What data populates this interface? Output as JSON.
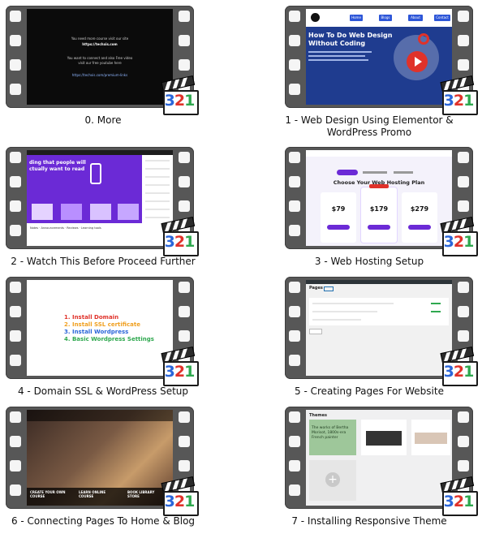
{
  "colors": {
    "accent_red": "#e0322a",
    "accent_blue": "#2b66d9",
    "accent_green": "#2fa84f",
    "strip": "#575757"
  },
  "badge": {
    "digits": [
      "3",
      "2",
      "1"
    ],
    "icon": "media-player-classic-icon"
  },
  "videos": [
    {
      "caption": "0. More",
      "thumb": {
        "kind": "dark",
        "lines": [
          "You need more course visit our site",
          "https://techxis.com",
          "",
          "You want to connect and also Free video",
          "visit our free youtube here",
          "",
          "https://techxis.com/premium-links"
        ]
      }
    },
    {
      "caption": "1 - Web Design Using Elementor & WordPress Promo",
      "thumb": {
        "kind": "promo",
        "nav": [
          "Home",
          "Blogs",
          "About Us",
          "Contact Us"
        ],
        "headline_1": "How To Do Web Design",
        "headline_2": "Without Coding"
      }
    },
    {
      "caption": "2 - Watch This Before Proceed Further",
      "thumb": {
        "kind": "purple",
        "headline_1": "ding that people will",
        "headline_2": "ctually want to read",
        "tabs": [
          "Notes",
          "Announcements",
          "Reviews",
          "Learning tools"
        ]
      }
    },
    {
      "caption": "3 - Web Hosting Setup",
      "thumb": {
        "kind": "hosting",
        "title": "Choose Your Web Hosting Plan",
        "prices": [
          "$79",
          "$179",
          "$279"
        ]
      }
    },
    {
      "caption": "4 - Domain SSL & WordPress Setup",
      "thumb": {
        "kind": "list",
        "items": [
          "1. Install Domain",
          "2. Install SSL certificate",
          "3. Install Wordpress",
          "4. Basic Wordpress Settings"
        ]
      }
    },
    {
      "caption": "5 - Creating Pages For Website",
      "thumb": {
        "kind": "admin",
        "title": "Pages"
      }
    },
    {
      "caption": "6 - Connecting Pages To Home & Blog",
      "thumb": {
        "kind": "photo",
        "bottom": [
          "CREATE YOUR OWN COURSE",
          "LEARN ONLINE COURSE",
          "BOOK LIBRARY STORE"
        ]
      }
    },
    {
      "caption": "7 - Installing Responsive Theme",
      "thumb": {
        "kind": "themes",
        "title": "Themes",
        "headline": "The works of Bertha Morisot, 1800s-era French painter"
      }
    }
  ]
}
